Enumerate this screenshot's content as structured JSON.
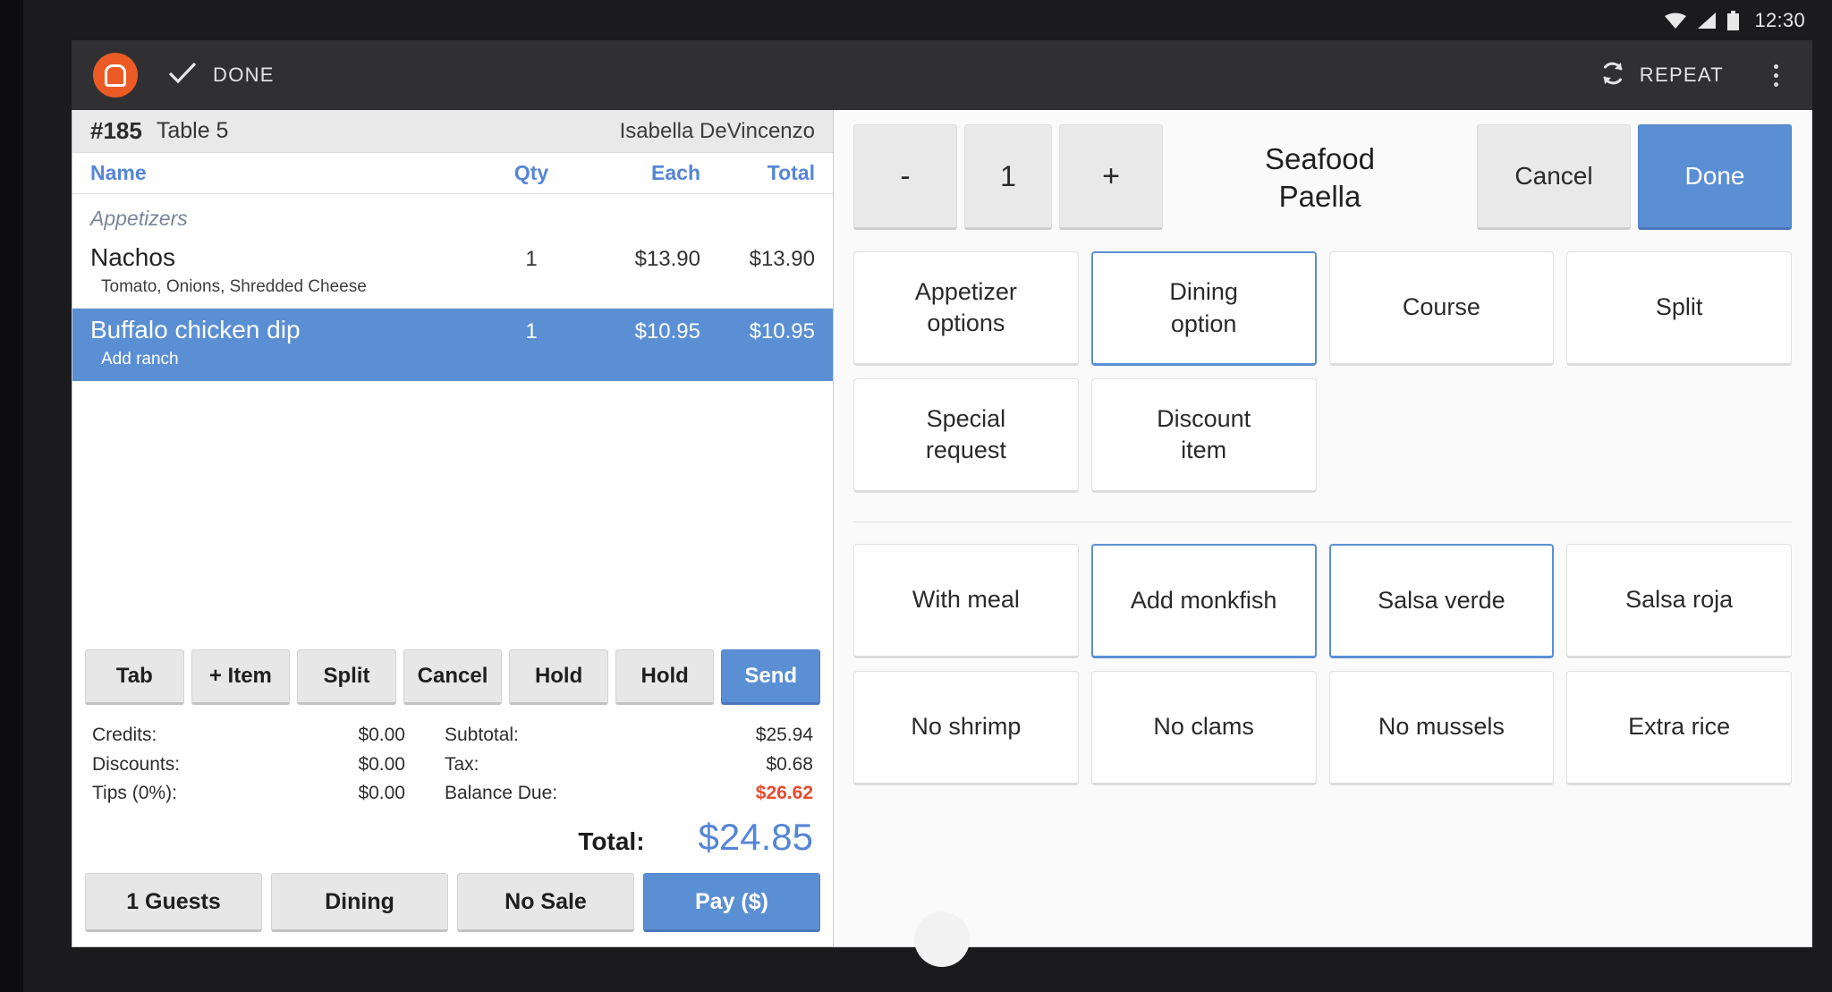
{
  "statusbar": {
    "time": "12:30",
    "icons": [
      "wifi-icon",
      "cell-signal-icon",
      "battery-icon"
    ]
  },
  "toolbar": {
    "logo": "clover-logo-icon",
    "check_icon": "check-icon",
    "done_label": "DONE",
    "repeat_icon": "repeat-icon",
    "repeat_label": "REPEAT",
    "overflow_icon": "overflow-menu-icon"
  },
  "order": {
    "number": "#185",
    "table": "Table 5",
    "server": "Isabella DeVincenzo",
    "columns": {
      "name": "Name",
      "qty": "Qty",
      "each": "Each",
      "total": "Total"
    },
    "group_label": "Appetizers",
    "items": [
      {
        "name": "Nachos",
        "qty": "1",
        "each": "$13.90",
        "total": "$13.90",
        "mods": "Tomato, Onions, Shredded Cheese",
        "selected": false
      },
      {
        "name": "Buffalo chicken dip",
        "qty": "1",
        "each": "$10.95",
        "total": "$10.95",
        "mods": "Add ranch",
        "selected": true
      }
    ],
    "actions": [
      {
        "label": "Tab",
        "primary": false
      },
      {
        "label": "+ Item",
        "primary": false
      },
      {
        "label": "Split",
        "primary": false
      },
      {
        "label": "Cancel",
        "primary": false
      },
      {
        "label": "Hold",
        "primary": false
      },
      {
        "label": "Hold",
        "primary": false
      },
      {
        "label": "Send",
        "primary": true
      }
    ],
    "totals": {
      "credits_label": "Credits:",
      "credits_value": "$0.00",
      "discounts_label": "Discounts:",
      "discounts_value": "$0.00",
      "tips_label": "Tips (0%):",
      "tips_value": "$0.00",
      "subtotal_label": "Subtotal:",
      "subtotal_value": "$25.94",
      "tax_label": "Tax:",
      "tax_value": "$0.68",
      "balance_label": "Balance Due:",
      "balance_value": "$26.62",
      "total_label": "Total:",
      "total_value": "$24.85"
    },
    "footer": [
      {
        "label": "1 Guests",
        "primary": false
      },
      {
        "label": "Dining",
        "primary": false
      },
      {
        "label": "No Sale",
        "primary": false
      },
      {
        "label": "Pay ($)",
        "primary": true
      }
    ]
  },
  "modifier_panel": {
    "decrement_label": "-",
    "quantity_value": "1",
    "increment_label": "+",
    "item_title": "Seafood\nPaella",
    "cancel_label": "Cancel",
    "done_label": "Done",
    "option_buttons": [
      {
        "label": "Appetizer\noptions",
        "selected": false
      },
      {
        "label": "Dining\noption",
        "selected": true
      },
      {
        "label": "Course",
        "selected": false
      },
      {
        "label": "Split",
        "selected": false
      },
      {
        "label": "Special\nrequest",
        "selected": false
      },
      {
        "label": "Discount\nitem",
        "selected": false
      }
    ],
    "modifier_buttons": [
      {
        "label": "With meal",
        "selected": false
      },
      {
        "label": "Add monkfish",
        "selected": true
      },
      {
        "label": "Salsa verde",
        "selected": true
      },
      {
        "label": "Salsa roja",
        "selected": false
      },
      {
        "label": "No shrimp",
        "selected": false
      },
      {
        "label": "No clams",
        "selected": false
      },
      {
        "label": "No mussels",
        "selected": false
      },
      {
        "label": "Extra rice",
        "selected": false
      }
    ]
  },
  "colors": {
    "accent_blue": "#5b8fd4",
    "brand_orange": "#ec5b25",
    "due_red": "#e8492e",
    "header_blue": "#5585d6"
  }
}
